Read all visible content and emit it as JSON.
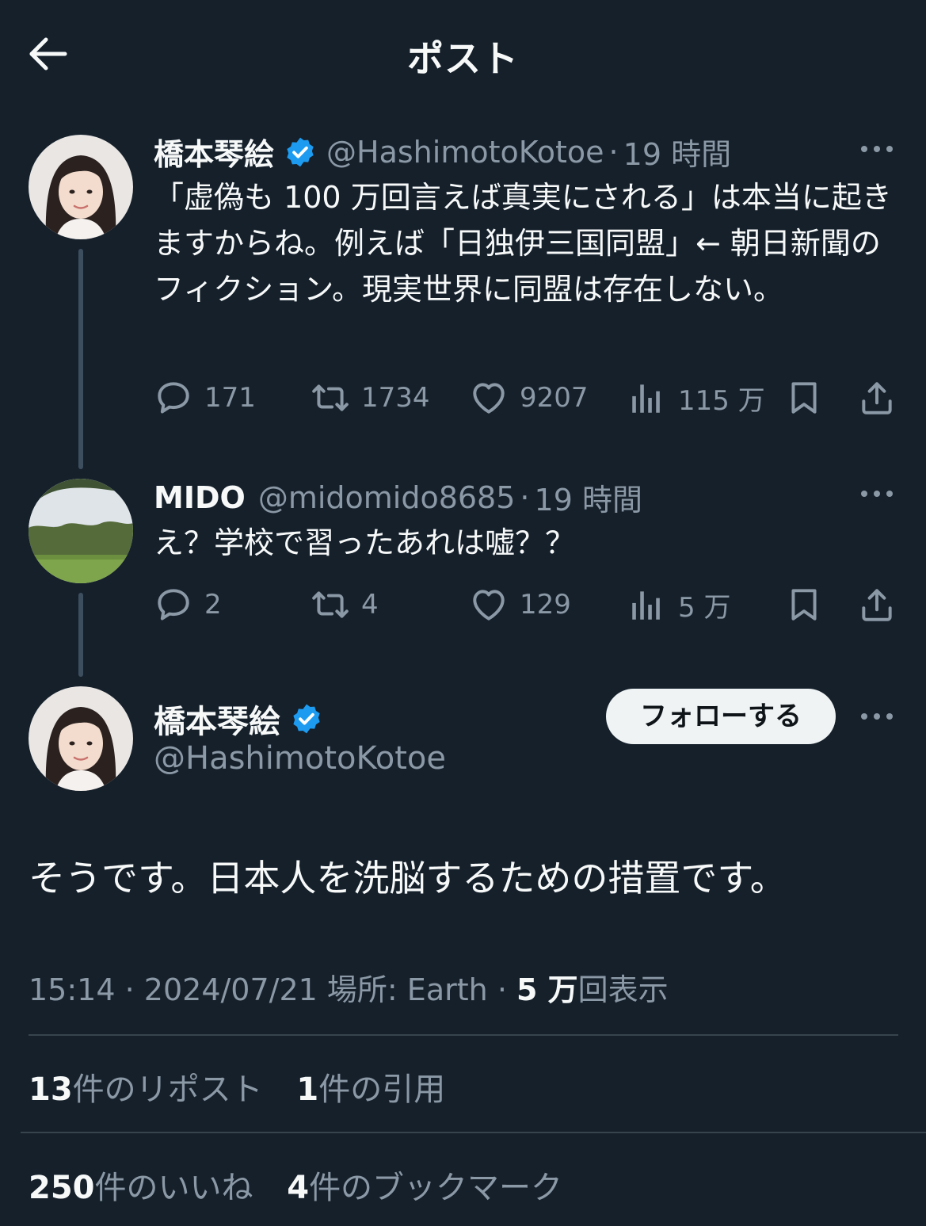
{
  "header": {
    "back_icon": "arrow-left-icon",
    "title": "ポスト"
  },
  "colors": {
    "background": "#15202b",
    "verified": "#1d9bf0",
    "follow_bg": "#eff3f4",
    "muted": "#8b98a5"
  },
  "tweets": [
    {
      "name": "橋本琴絵",
      "verified": true,
      "handle": "@HashimotoKotoe",
      "separator": "·",
      "time": "19 時間",
      "text": "「虚偽も 100 万回言えば真実にされる」は本当に起きますからね。例えば「日独伊三国同盟」← 朝日新聞のフィクション。現実世界に同盟は存在しない。",
      "replies": "171",
      "reposts": "1734",
      "likes": "9207",
      "views": "115 万"
    },
    {
      "name": "MIDO",
      "verified": false,
      "handle": "@midomido8685",
      "separator": "·",
      "time": "19 時間",
      "text": "え？学校で習ったあれは嘘？？",
      "replies": "2",
      "reposts": "4",
      "likes": "129",
      "views": "5 万"
    }
  ],
  "main_post": {
    "name": "橋本琴絵",
    "handle": "@HashimotoKotoe",
    "follow_label": "フォローする",
    "text": "そうです。日本人を洗脳するための措置です。",
    "time": "15:14",
    "sep1": "·",
    "date": "2024/07/21",
    "location": "場所: Earth",
    "sep2": "·",
    "views_count": "5 万",
    "views_label": "回表示",
    "reposts_count": "13",
    "reposts_label": "件のリポスト",
    "quotes_count": "1",
    "quotes_label": "件の引用",
    "likes_count": "250",
    "likes_label": "件のいいね",
    "bookmarks_count": "4",
    "bookmarks_label": "件のブックマーク"
  }
}
